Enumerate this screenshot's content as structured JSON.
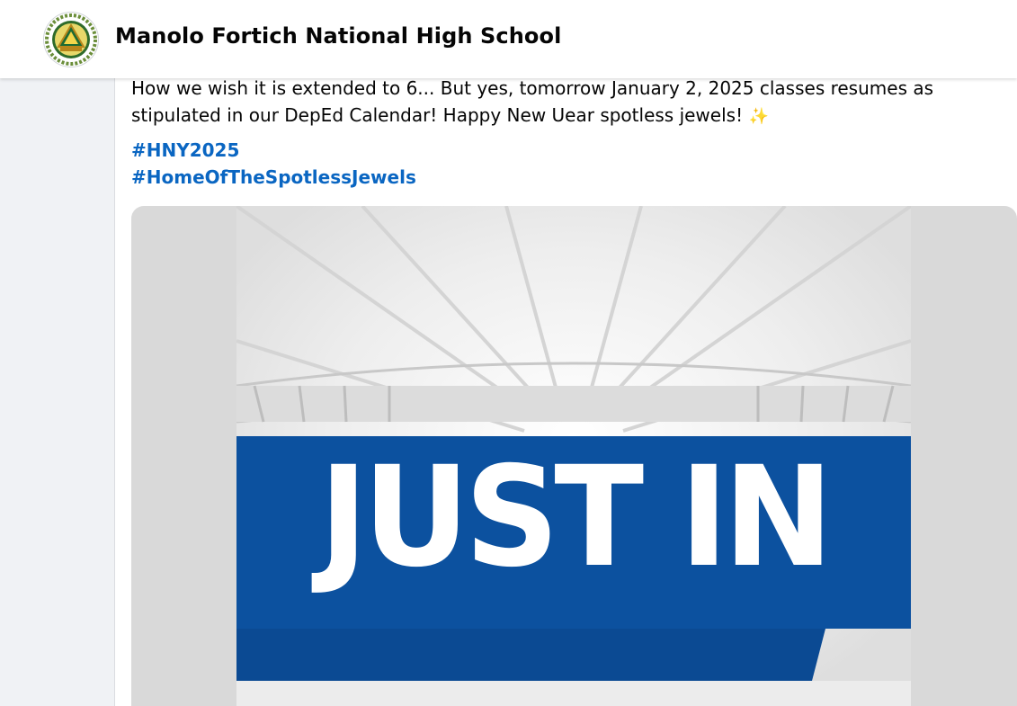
{
  "post": {
    "page_name": "Manolo Fortich National High School",
    "text": "How we wish it is extended to 6... But yes, tomorrow January 2, 2025 classes resumes as stipulated in our DepEd Calendar! Happy New Uear spotless jewels! ",
    "emoji": "✨",
    "hashtags": [
      "#HNY2025",
      "#HomeOfTheSpotlessJewels"
    ]
  },
  "media": {
    "overlay_text": "JUST IN"
  },
  "colors": {
    "hashtag": "#0a66c2",
    "banner_blue": "#0d56a6",
    "banner_dark": "#0b4a93"
  }
}
